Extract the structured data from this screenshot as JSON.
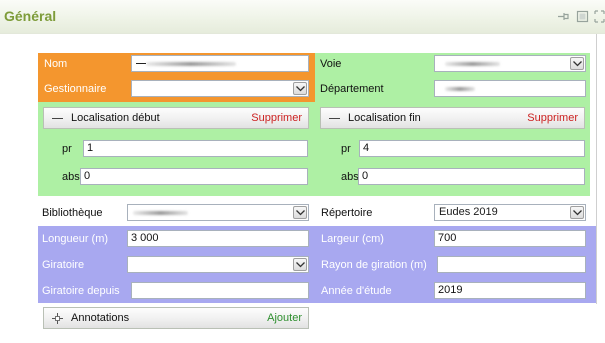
{
  "panel": {
    "title": "Général",
    "header_icons": [
      "pin-icon",
      "window-icon",
      "maximize-icon"
    ]
  },
  "nom": {
    "label": "Nom",
    "value": ""
  },
  "voie": {
    "label": "Voie",
    "value": ""
  },
  "gestionnaire": {
    "label": "Gestionnaire",
    "value": ""
  },
  "departement": {
    "label": "Département",
    "value": ""
  },
  "loc_debut": {
    "title": "Localisation début",
    "action": "Supprimer",
    "pr_label": "pr",
    "pr_value": "1",
    "abs_label": "abs",
    "abs_value": "0"
  },
  "loc_fin": {
    "title": "Localisation fin",
    "action": "Supprimer",
    "pr_label": "pr",
    "pr_value": "4",
    "abs_label": "abs",
    "abs_value": "0"
  },
  "bibliotheque": {
    "label": "Bibliothèque",
    "value": ""
  },
  "repertoire": {
    "label": "Répertoire",
    "value": "Eudes 2019"
  },
  "longueur": {
    "label": "Longueur (m)",
    "value": "3 000"
  },
  "largeur": {
    "label": "Largeur (cm)",
    "value": "700"
  },
  "giratoire": {
    "label": "Giratoire",
    "value": ""
  },
  "rayon_giration": {
    "label": "Rayon de giration (m)",
    "value": ""
  },
  "giratoire_depuis": {
    "label": "Giratoire depuis",
    "value": ""
  },
  "annee_etude": {
    "label": "Année d'étude",
    "value": "2019"
  },
  "annotations": {
    "title": "Annotations",
    "action": "Ajouter"
  },
  "colors": {
    "orange": "#f4962e",
    "green": "#aef0a4",
    "blue": "#a8a8f0",
    "title_green": "#7e9c3a",
    "delete_red": "#cc2222",
    "add_green": "#2f8f2f"
  }
}
